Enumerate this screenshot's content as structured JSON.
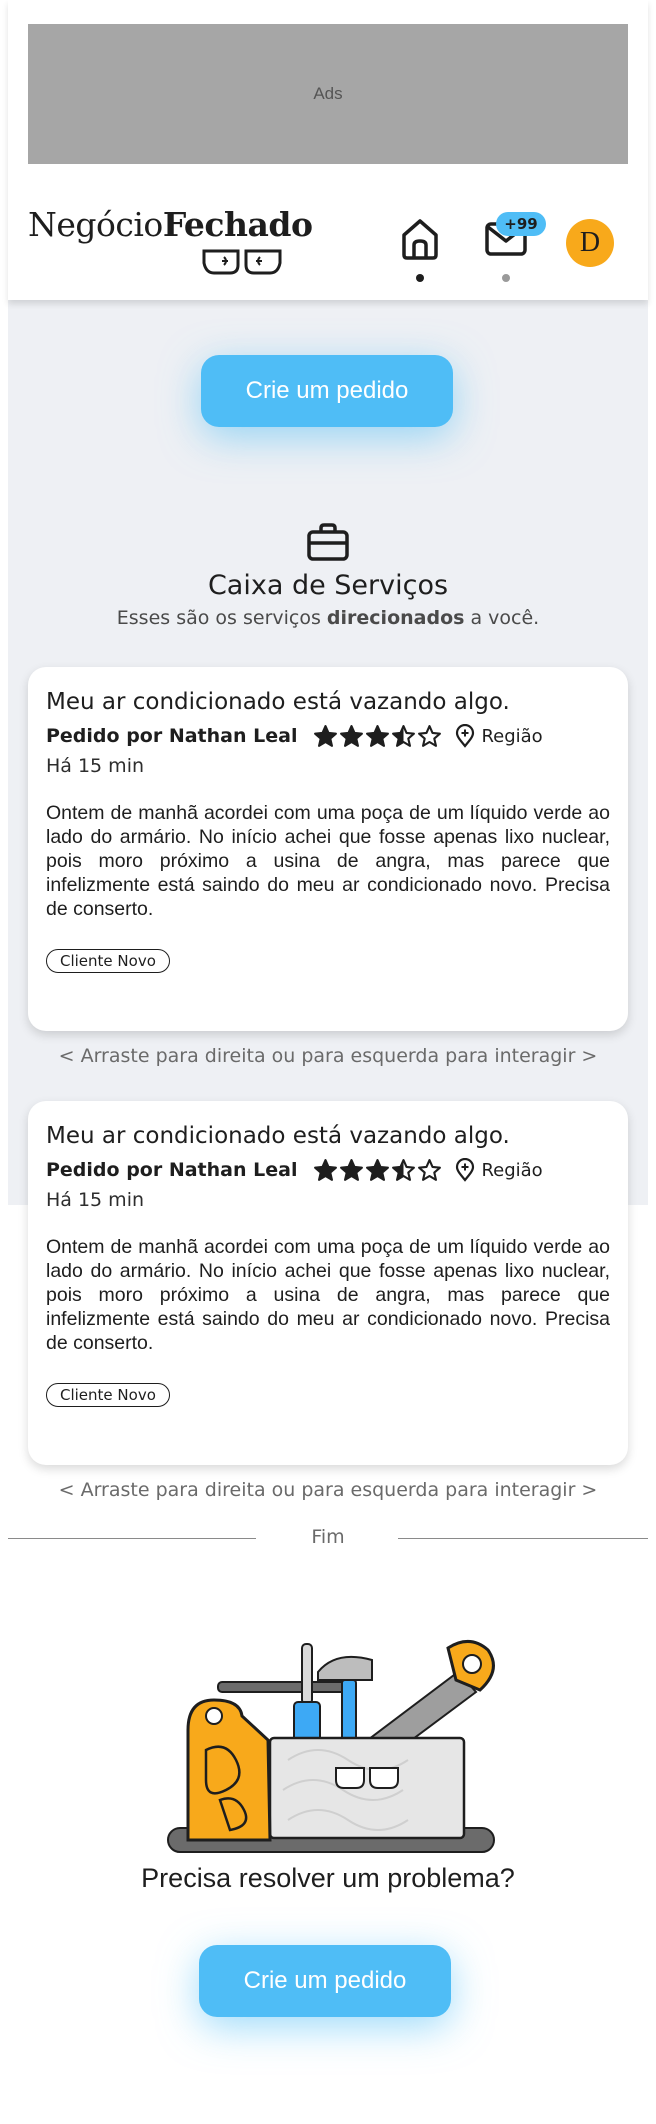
{
  "ads": {
    "label": "Ads"
  },
  "logo": {
    "part1": "Negócio",
    "part2": "Fechado"
  },
  "nav": {
    "home_icon": "home-icon",
    "mail_icon": "mail-icon",
    "mail_badge": "+99",
    "avatar_initial": "D"
  },
  "colors": {
    "accent": "#4fbdf6",
    "avatar": "#f8a91b",
    "background_section": "#eef0f4"
  },
  "cta": {
    "top_label": "Crie um pedido",
    "bottom_label": "Crie um pedido"
  },
  "section": {
    "icon": "briefcase-icon",
    "title": "Caixa de Serviços",
    "subtitle_pre": "Esses são os serviços ",
    "subtitle_bold": "direcionados",
    "subtitle_post": " a você."
  },
  "cards": [
    {
      "title": "Meu ar condicionado está vazando algo.",
      "author": "Pedido por Nathan Leal",
      "rating": 3.5,
      "rating_max": 5,
      "region": "Região",
      "time": "Há 15 min",
      "body": "Ontem de manhã acordei com uma poça de um líquido verde ao lado do armário. No início achei que fosse apenas lixo nuclear, pois moro próximo a usina de angra, mas parece que infelizmente está saindo do meu ar condicionado novo. Precisa de conserto.",
      "tag": "Cliente Novo"
    },
    {
      "title": "Meu ar condicionado está vazando algo.",
      "author": "Pedido por Nathan Leal",
      "rating": 3.5,
      "rating_max": 5,
      "region": "Região",
      "time": "Há 15 min",
      "body": "Ontem de manhã acordei com uma poça de um líquido verde ao lado do armário. No início achei que fosse apenas lixo nuclear, pois moro próximo a usina de angra, mas parece que infelizmente está saindo do meu ar condicionado novo. Precisa de conserto.",
      "tag": "Cliente Novo"
    }
  ],
  "swipe_hint": "<  Arraste para direita ou para esquerda para interagir  >",
  "end_label": "Fim",
  "bottom": {
    "illustration": "toolbox-illustration",
    "title": "Precisa resolver um problema?"
  }
}
